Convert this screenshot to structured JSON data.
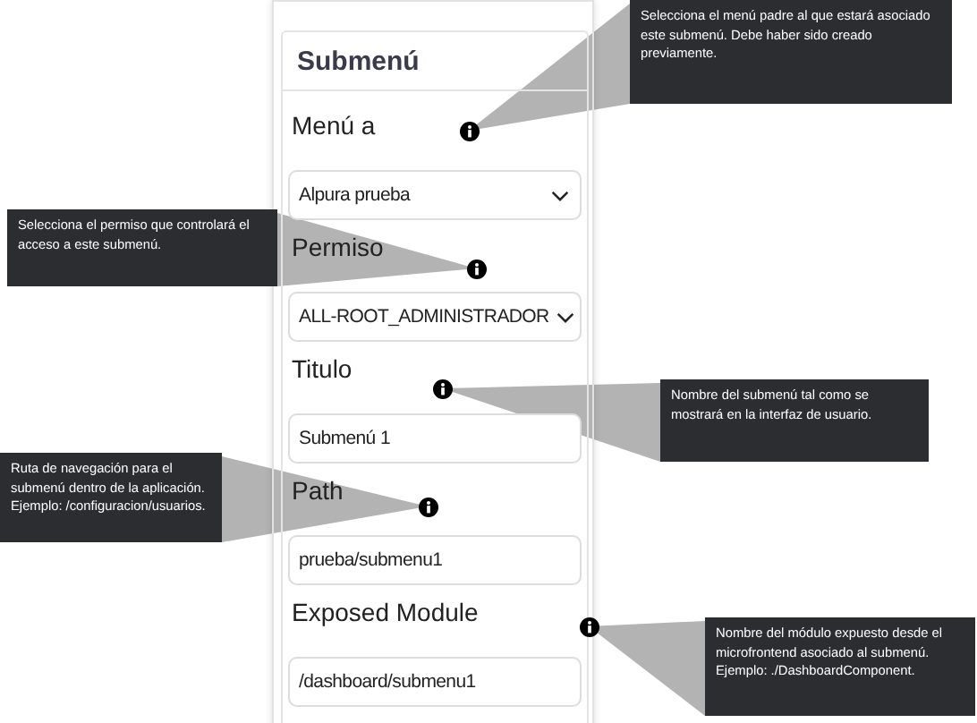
{
  "panel": {
    "title": "Submenú",
    "fields": [
      {
        "kind": "select",
        "label": "Menú a",
        "value": "Alpura prueba"
      },
      {
        "kind": "select",
        "label": "Permiso",
        "value": "ALL-ROOT_ADMINISTRADOR"
      },
      {
        "kind": "text",
        "label": "Titulo",
        "value": "Submenú 1"
      },
      {
        "kind": "text",
        "label": "Path",
        "value": "prueba/submenu1"
      },
      {
        "kind": "text",
        "label": "Exposed Module",
        "value": "/dashboard/submenu1"
      }
    ]
  },
  "callouts": [
    {
      "text": "Selecciona el menú padre al que estará asociado este submenú. Debe haber sido creado previamente."
    },
    {
      "text": "Selecciona el permiso que controlará el acceso a este submenú."
    },
    {
      "text": "Nombre del submenú tal como se mostrará en la interfaz de usuario."
    },
    {
      "text": "Ruta de navegación para el submenú dentro de la aplicación. Ejemplo: /configuracion/usuarios."
    },
    {
      "text": "Nombre del módulo expuesto desde el microfrontend asociado al submenú. Ejemplo: ./DashboardComponent."
    }
  ]
}
